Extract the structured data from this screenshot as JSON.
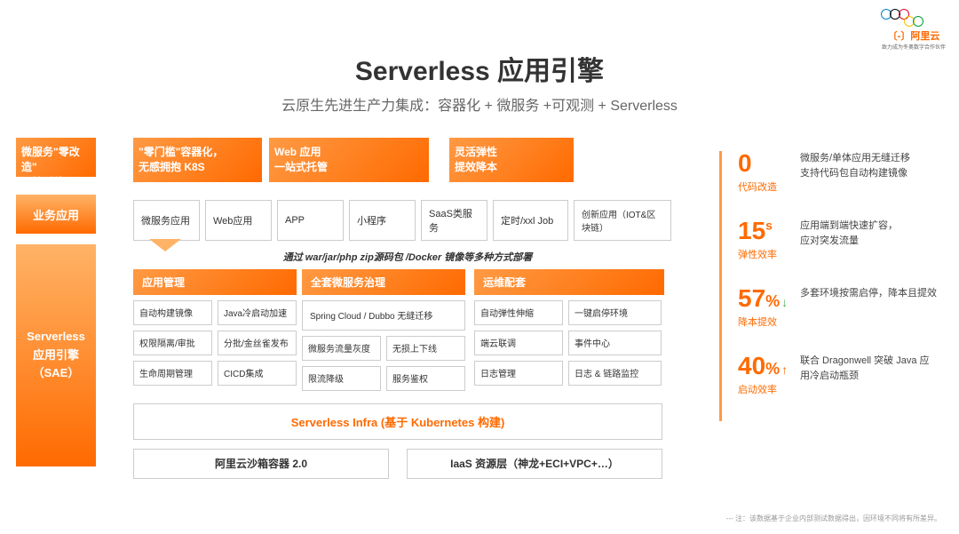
{
  "logo": {
    "brand": "〔-〕阿里云",
    "tagline": "致力成为冬奥数字合作伙伴"
  },
  "header": {
    "title": "Serverless 应用引擎",
    "subtitle": "云原生先进生产力集成：容器化 + 微服务 +可观测 + Serverless"
  },
  "topHeaders": [
    "微服务\"零改造\"\n无缝迁移",
    "\"零门槛\"容器化，\n无感拥抱 K8S",
    "Web 应用\n一站式托管",
    "灵活弹性\n提效降本"
  ],
  "sideLabels": {
    "biz": "业务应用",
    "sae": "Serverless\n应用引擎\n（SAE）"
  },
  "bizBoxes": [
    "微服务应用",
    "Web应用",
    "APP",
    "小程序",
    "SaaS类服务",
    "定时/xxl Job",
    "创新应用（IOT&区块链）"
  ],
  "dividerText": "通过 war/jar/php zip源码包 /Docker 镜像等多种方式部署",
  "mgmtHeaders": [
    "应用管理",
    "全套微服务治理",
    "运维配套"
  ],
  "mgmtCols": [
    [
      [
        "自动构建镜像",
        "Java冷启动加速"
      ],
      [
        "权限隔离/审批",
        "分批/金丝雀发布"
      ],
      [
        "生命周期管理",
        "CICD集成"
      ]
    ],
    [
      [
        "Spring Cloud / Dubbo 无缝迁移"
      ],
      [
        "微服务流量灰度",
        "无损上下线"
      ],
      [
        "限流降级",
        "服务鉴权"
      ]
    ],
    [
      [
        "自动弹性伸缩",
        "一键启停环境"
      ],
      [
        "端云联调",
        "事件中心"
      ],
      [
        "日志管理",
        "日志 & 链路监控"
      ]
    ]
  ],
  "infra": "Serverless Infra (基于 Kubernetes 构建)",
  "iaas": [
    "阿里云沙箱容器 2.0",
    "IaaS 资源层（神龙+ECI+VPC+…）"
  ],
  "stats": [
    {
      "num": "0",
      "sup": "",
      "label": "代码改造",
      "desc": "微服务/单体应用无缝迁移\n支持代码包自动构建镜像",
      "arrow": ""
    },
    {
      "num": "15",
      "sup": "s",
      "label": "弹性效率",
      "desc": "应用端到端快速扩容，\n应对突发流量",
      "arrow": ""
    },
    {
      "num": "57",
      "sup": "%",
      "label": "降本提效",
      "desc": "多套环境按需启停，降本且提效",
      "arrow": "down"
    },
    {
      "num": "40",
      "sup": "%",
      "label": "启动效率",
      "desc": "联合 Dragonwell 突破 Java 应用冷启动瓶颈",
      "arrow": "up"
    }
  ],
  "footnote": "--- 注：该数据基于企业内部测试数据得出，因环境不同将有所差异。"
}
